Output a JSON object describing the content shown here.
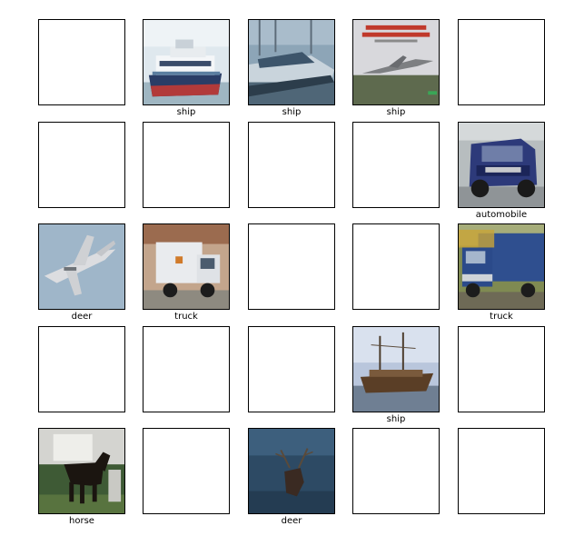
{
  "grid": {
    "rows": 5,
    "cols": 5,
    "cells": [
      {
        "label": "",
        "thumbnail": "none"
      },
      {
        "label": "ship",
        "thumbnail": "ferry-boat"
      },
      {
        "label": "ship",
        "thumbnail": "motor-yacht"
      },
      {
        "label": "ship",
        "thumbnail": "concorde-book-cover"
      },
      {
        "label": "",
        "thumbnail": "none"
      },
      {
        "label": "",
        "thumbnail": "none"
      },
      {
        "label": "",
        "thumbnail": "none"
      },
      {
        "label": "",
        "thumbnail": "none"
      },
      {
        "label": "",
        "thumbnail": "none"
      },
      {
        "label": "automobile",
        "thumbnail": "blue-suv"
      },
      {
        "label": "deer",
        "thumbnail": "fighter-jet"
      },
      {
        "label": "truck",
        "thumbnail": "box-truck"
      },
      {
        "label": "",
        "thumbnail": "none"
      },
      {
        "label": "",
        "thumbnail": "none"
      },
      {
        "label": "truck",
        "thumbnail": "blue-lorry"
      },
      {
        "label": "",
        "thumbnail": "none"
      },
      {
        "label": "",
        "thumbnail": "none"
      },
      {
        "label": "",
        "thumbnail": "none"
      },
      {
        "label": "ship",
        "thumbnail": "old-wooden-ship"
      },
      {
        "label": "",
        "thumbnail": "none"
      },
      {
        "label": "horse",
        "thumbnail": "dark-horse"
      },
      {
        "label": "",
        "thumbnail": "none"
      },
      {
        "label": "deer",
        "thumbnail": "deer-in-night"
      },
      {
        "label": "",
        "thumbnail": "none"
      },
      {
        "label": "",
        "thumbnail": "none"
      }
    ]
  },
  "colors": {
    "frame": "#000000",
    "background": "#ffffff",
    "label_text": "#000000"
  }
}
